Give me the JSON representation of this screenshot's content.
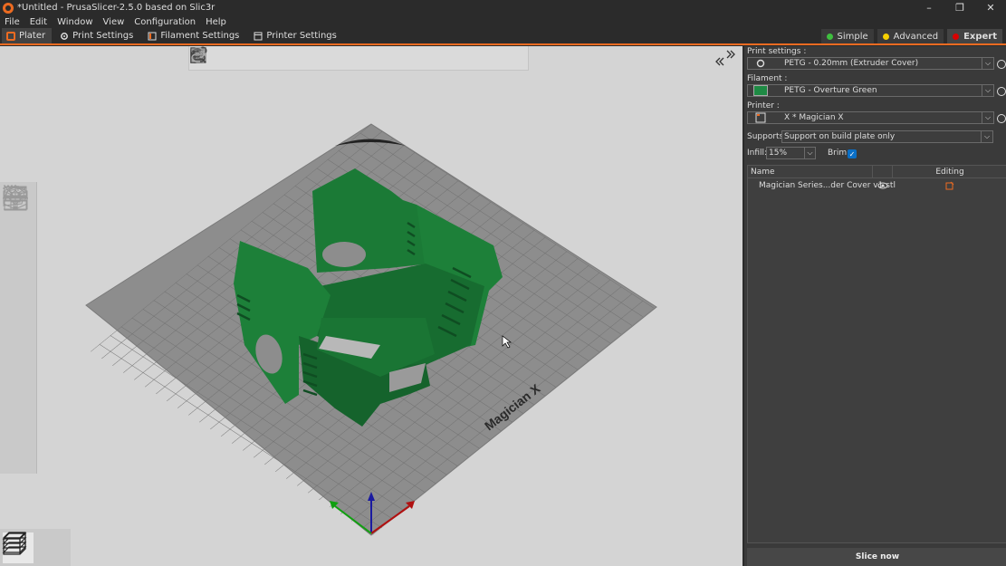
{
  "window": {
    "title": "*Untitled - PrusaSlicer-2.5.0 based on Slic3r",
    "minimize": "–",
    "maximize": "❐",
    "close": "✕"
  },
  "menu": [
    "File",
    "Edit",
    "Window",
    "View",
    "Configuration",
    "Help"
  ],
  "tabs": [
    {
      "label": "Plater",
      "active": true
    },
    {
      "label": "Print Settings",
      "active": false
    },
    {
      "label": "Filament Settings",
      "active": false
    },
    {
      "label": "Printer Settings",
      "active": false
    }
  ],
  "modes": [
    {
      "label": "Simple",
      "color": "#3fbf3f"
    },
    {
      "label": "Advanced",
      "color": "#f5d000"
    },
    {
      "label": "Expert",
      "color": "#d80000",
      "active": true
    }
  ],
  "sidebar": {
    "print_settings_label": "Print settings :",
    "print_settings_value": "PETG - 0.20mm (Extruder Cover)",
    "filament_label": "Filament :",
    "filament_value": "PETG - Overture Green",
    "filament_color": "#1e8a44",
    "printer_label": "Printer :",
    "printer_value": "X * Magician X",
    "supports_label": "Supports:",
    "supports_value": "Support on build plate only",
    "infill_label": "Infill:",
    "infill_value": "15%",
    "brim_label": "Brim:",
    "brim_checked": true,
    "columns": {
      "name": "Name",
      "editing": "Editing"
    },
    "objects": [
      {
        "name": "Magician Series...der Cover v1.stl"
      }
    ],
    "slice_label": "Slice now"
  },
  "viewport": {
    "bed_label": "Magician X",
    "model_color": "#1b7a36",
    "bed_color": "#8d8d8d",
    "background": "#d4d4d4"
  },
  "icons": {
    "toolbar": [
      "add-icon",
      "delete-icon",
      "delete-all-icon",
      "arrange-icon",
      "copy-icon",
      "paste-icon",
      "add-instance-icon",
      "remove-instance-icon",
      "split-objects-icon",
      "split-parts-icon",
      "search-icon",
      "layers-icon",
      "undo-icon",
      "redo-icon"
    ],
    "gizmos": [
      "move-icon",
      "scale-icon",
      "rotate-icon",
      "place-on-face-icon",
      "cut-icon",
      "hollow-icon",
      "support-points-icon",
      "seam-painting-icon"
    ]
  }
}
